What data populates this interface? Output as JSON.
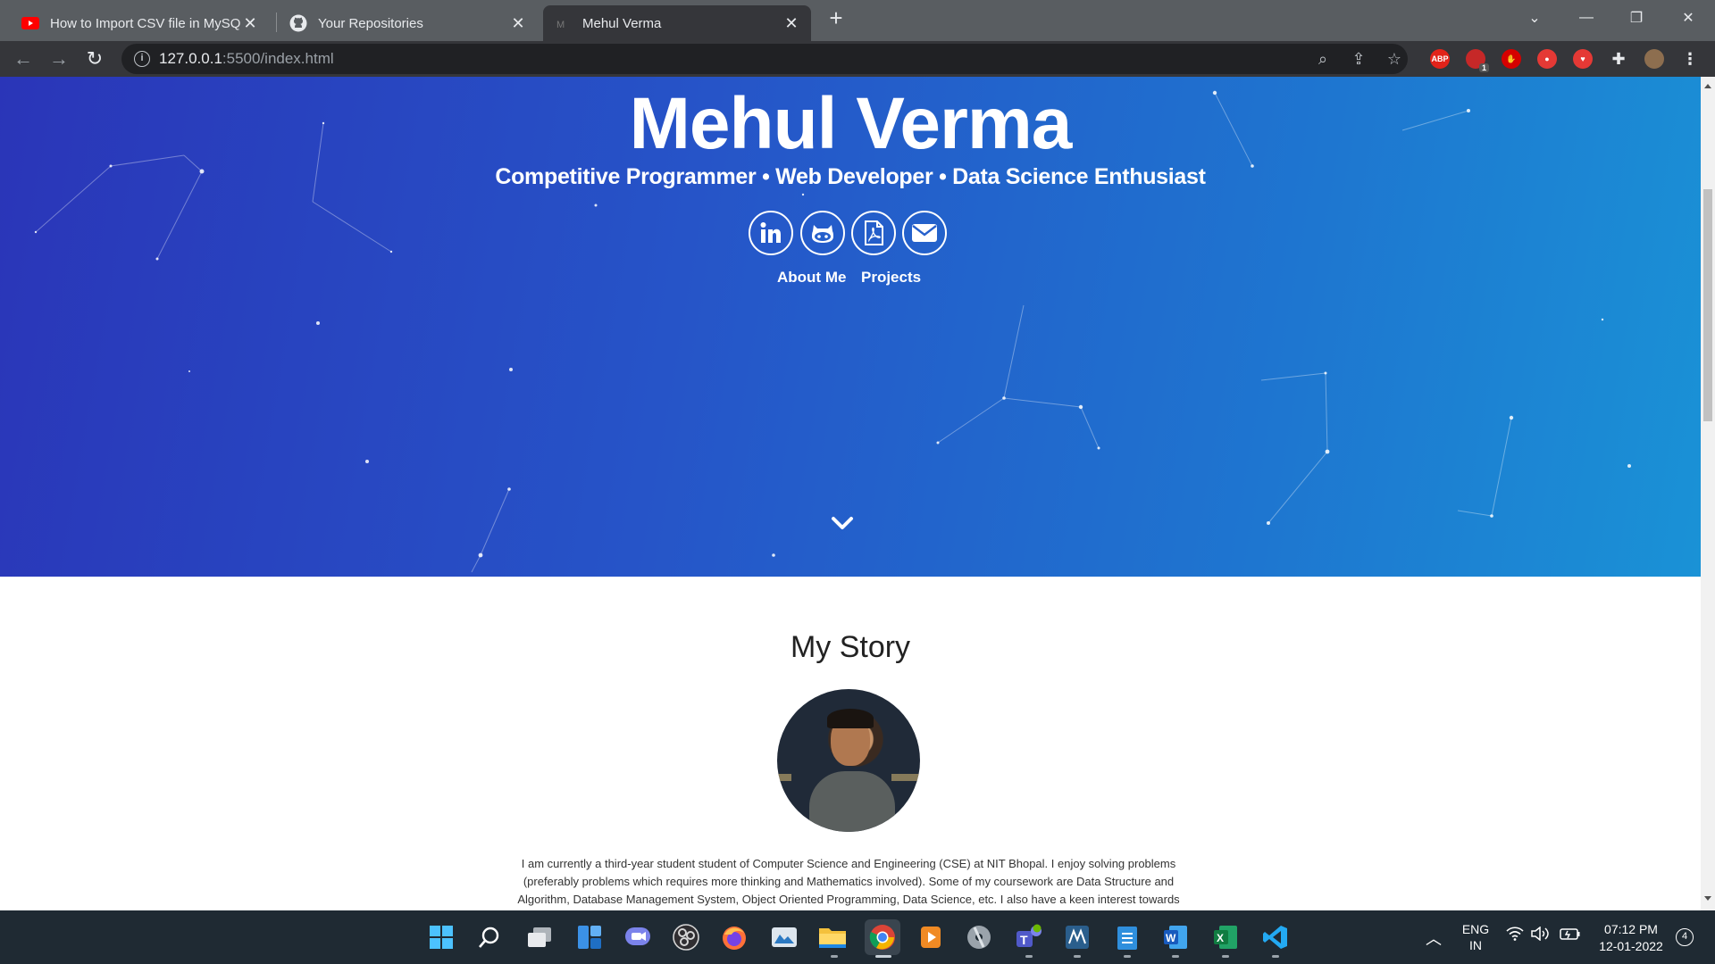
{
  "browser": {
    "tabs": [
      {
        "title": "How to Import CSV file in MySQL",
        "favicon": "youtube-icon"
      },
      {
        "title": "Your Repositories",
        "favicon": "github-icon"
      },
      {
        "title": "Mehul Verma",
        "favicon": "page-icon",
        "active": true
      }
    ],
    "url_host": "127.0.0.1",
    "url_path": ":5500/index.html"
  },
  "hero": {
    "name": "Mehul Verma",
    "subtitle": "Competitive Programmer • Web Developer • Data Science Enthusiast",
    "social": [
      "linkedin-icon",
      "github-icon",
      "pdf-resume-icon",
      "email-icon"
    ],
    "links": {
      "about": "About Me",
      "projects": "Projects"
    }
  },
  "story": {
    "title": "My Story",
    "text": "I am currently a third-year student student of Computer Science and Engineering (CSE) at NIT Bhopal. I enjoy solving problems (preferably problems which requires more thinking and Mathematics involved). Some of my coursework are Data Structure and Algorithm, Database Management System, Object Oriented Programming, Data Science, etc. I also have a keen interest towards"
  },
  "extensions": {
    "abp": "ABP",
    "badge": "1"
  },
  "taskbar": {
    "lang_top": "ENG",
    "lang_bottom": "IN",
    "time": "07:12 PM",
    "date": "12-01-2022",
    "notifications": "4"
  },
  "colors": {
    "hero_start": "#2a35b8",
    "hero_end": "#1a92d6",
    "tabbar": "#595d61",
    "toolbar": "#35363a"
  }
}
